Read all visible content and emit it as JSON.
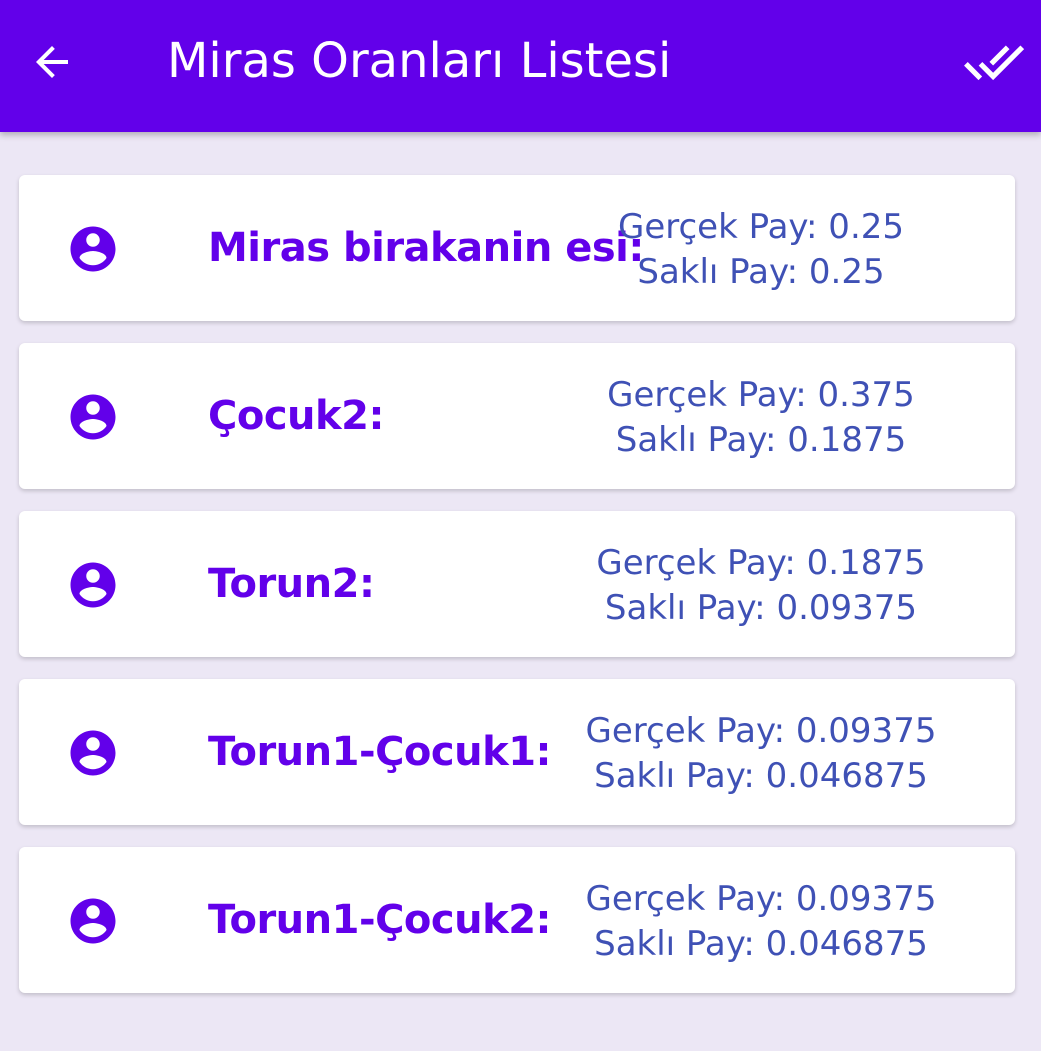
{
  "appbar": {
    "title": "Miras Oranları Listesi",
    "background": "#6200ea",
    "back_icon": "arrow-back-icon",
    "done_icon": "done-all-icon"
  },
  "colors": {
    "name_text": "#6200ea",
    "share_text": "#3f51b5",
    "page_background": "#ece7f5"
  },
  "heirs": [
    {
      "name": "Miras birakanin esi:",
      "gercek": "Gerçek Pay: 0.25",
      "sakli": "Saklı Pay: 0.25"
    },
    {
      "name": "Çocuk2:",
      "gercek": "Gerçek Pay: 0.375",
      "sakli": "Saklı Pay: 0.1875"
    },
    {
      "name": "Torun2:",
      "gercek": "Gerçek Pay: 0.1875",
      "sakli": "Saklı Pay: 0.09375"
    },
    {
      "name": "Torun1-Çocuk1:",
      "gercek": "Gerçek Pay: 0.09375",
      "sakli": "Saklı Pay: 0.046875"
    },
    {
      "name": "Torun1-Çocuk2:",
      "gercek": "Gerçek Pay: 0.09375",
      "sakli": "Saklı Pay: 0.046875"
    }
  ]
}
